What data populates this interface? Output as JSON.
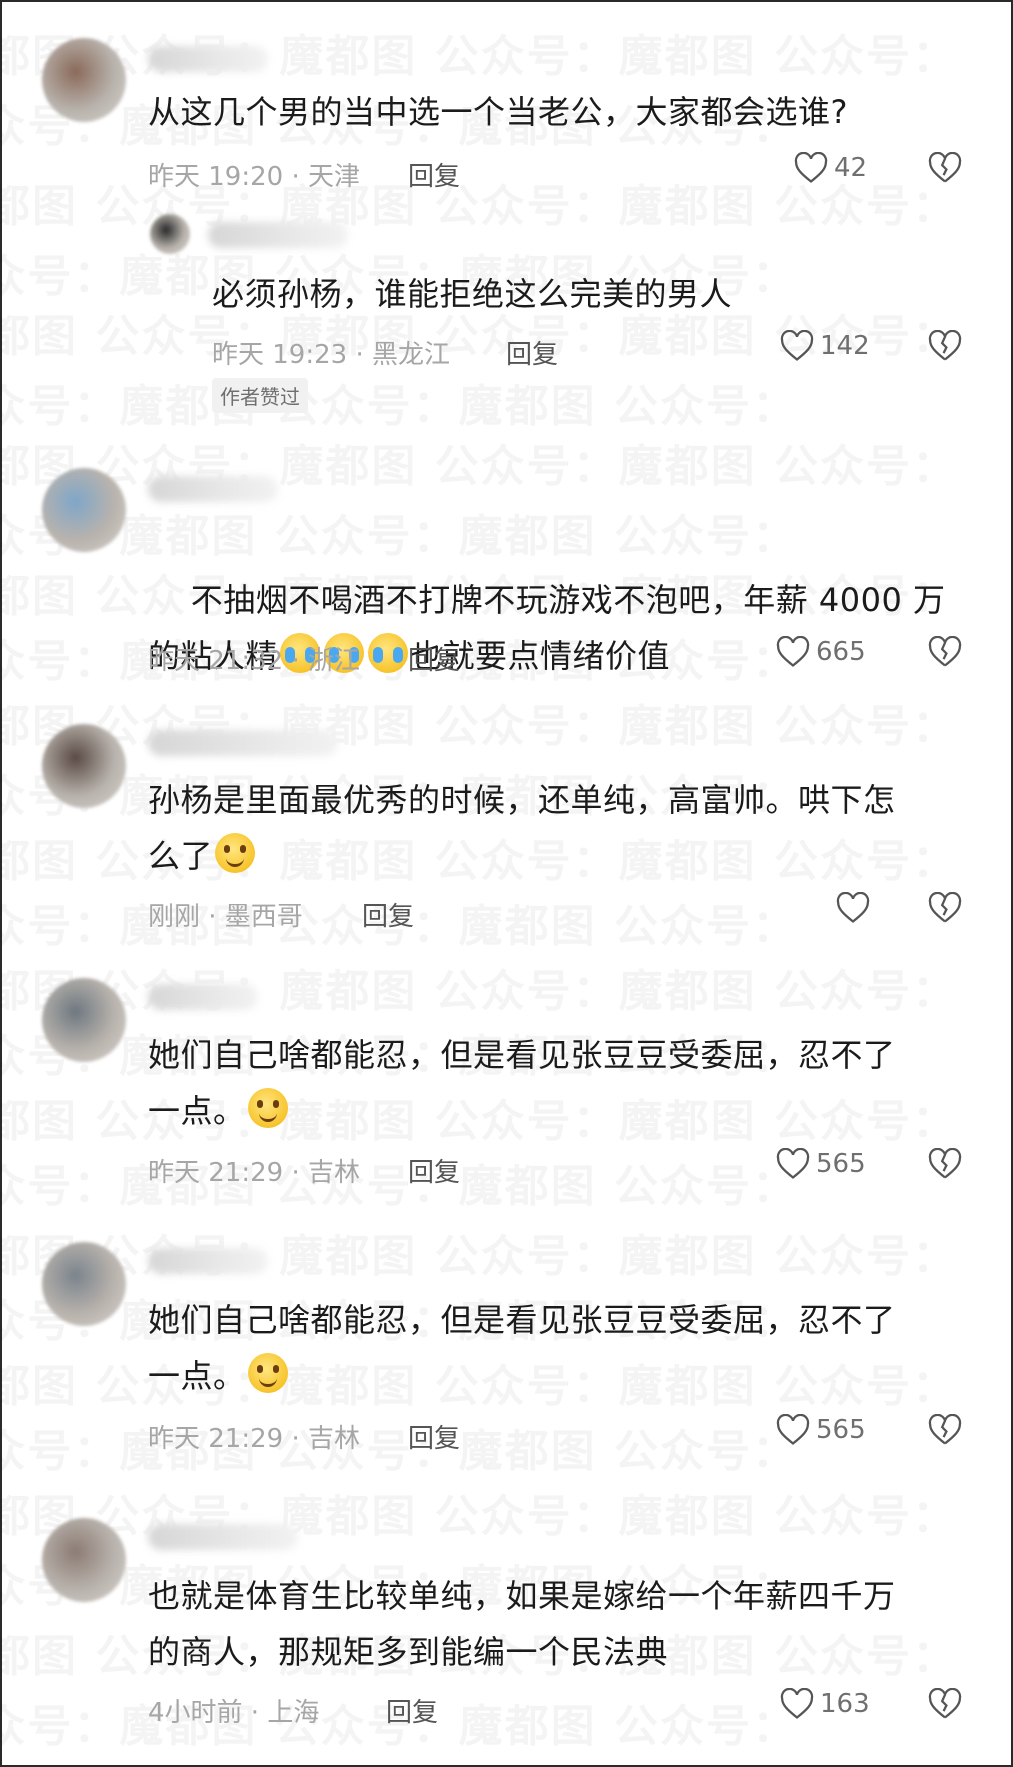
{
  "watermark": "魔都图 公众号：魔都图 公众号：魔都图 公众号：",
  "comments": [
    {
      "text": "从这几个男的当中选一个当老公，大家都会选谁?",
      "time_loc": "昨天 19:20 · 天津",
      "reply": "回复",
      "likes": "42",
      "avatar_color": "#8a6a5a"
    },
    {
      "text": "必须孙杨，谁能拒绝这么完美的男人",
      "time_loc": "昨天 19:23 · 黑龙江",
      "reply": "回复",
      "likes": "142",
      "author_tag": "作者赞过",
      "avatar_color": "#2a2a2a"
    },
    {
      "text": "不抽烟不喝酒不打牌不玩游戏不泡吧，年薪 4000 万\n的粘人精",
      "text_after": "也就要点情绪价值",
      "time_loc": "昨天 21:32 · 浙江",
      "reply": "回复",
      "likes": "665",
      "avatar_color": "#7fa6c8"
    },
    {
      "text": "孙杨是里面最优秀的时候，还单纯，高富帅。哄下怎\n么了",
      "time_loc": "刚刚 · 墨西哥",
      "reply": "回复",
      "likes": "",
      "avatar_color": "#5a4a44"
    },
    {
      "text": "她们自己啥都能忍，但是看见张豆豆受委屈，忍不了\n一点。",
      "time_loc": "昨天 21:29 · 吉林",
      "reply": "回复",
      "likes": "565",
      "avatar_color": "#6e7880"
    },
    {
      "text": "她们自己啥都能忍，但是看见张豆豆受委屈，忍不了\n一点。",
      "time_loc": "昨天 21:29 · 吉林",
      "reply": "回复",
      "likes": "565",
      "avatar_color": "#7a848c"
    },
    {
      "text": "也就是体育生比较单纯，如果是嫁给一个年薪四千万\n的商人，那规矩多到能编一个民法典",
      "time_loc": "4小时前 · 上海",
      "reply": "回复",
      "likes": "163",
      "avatar_color": "#8c7c74"
    }
  ]
}
